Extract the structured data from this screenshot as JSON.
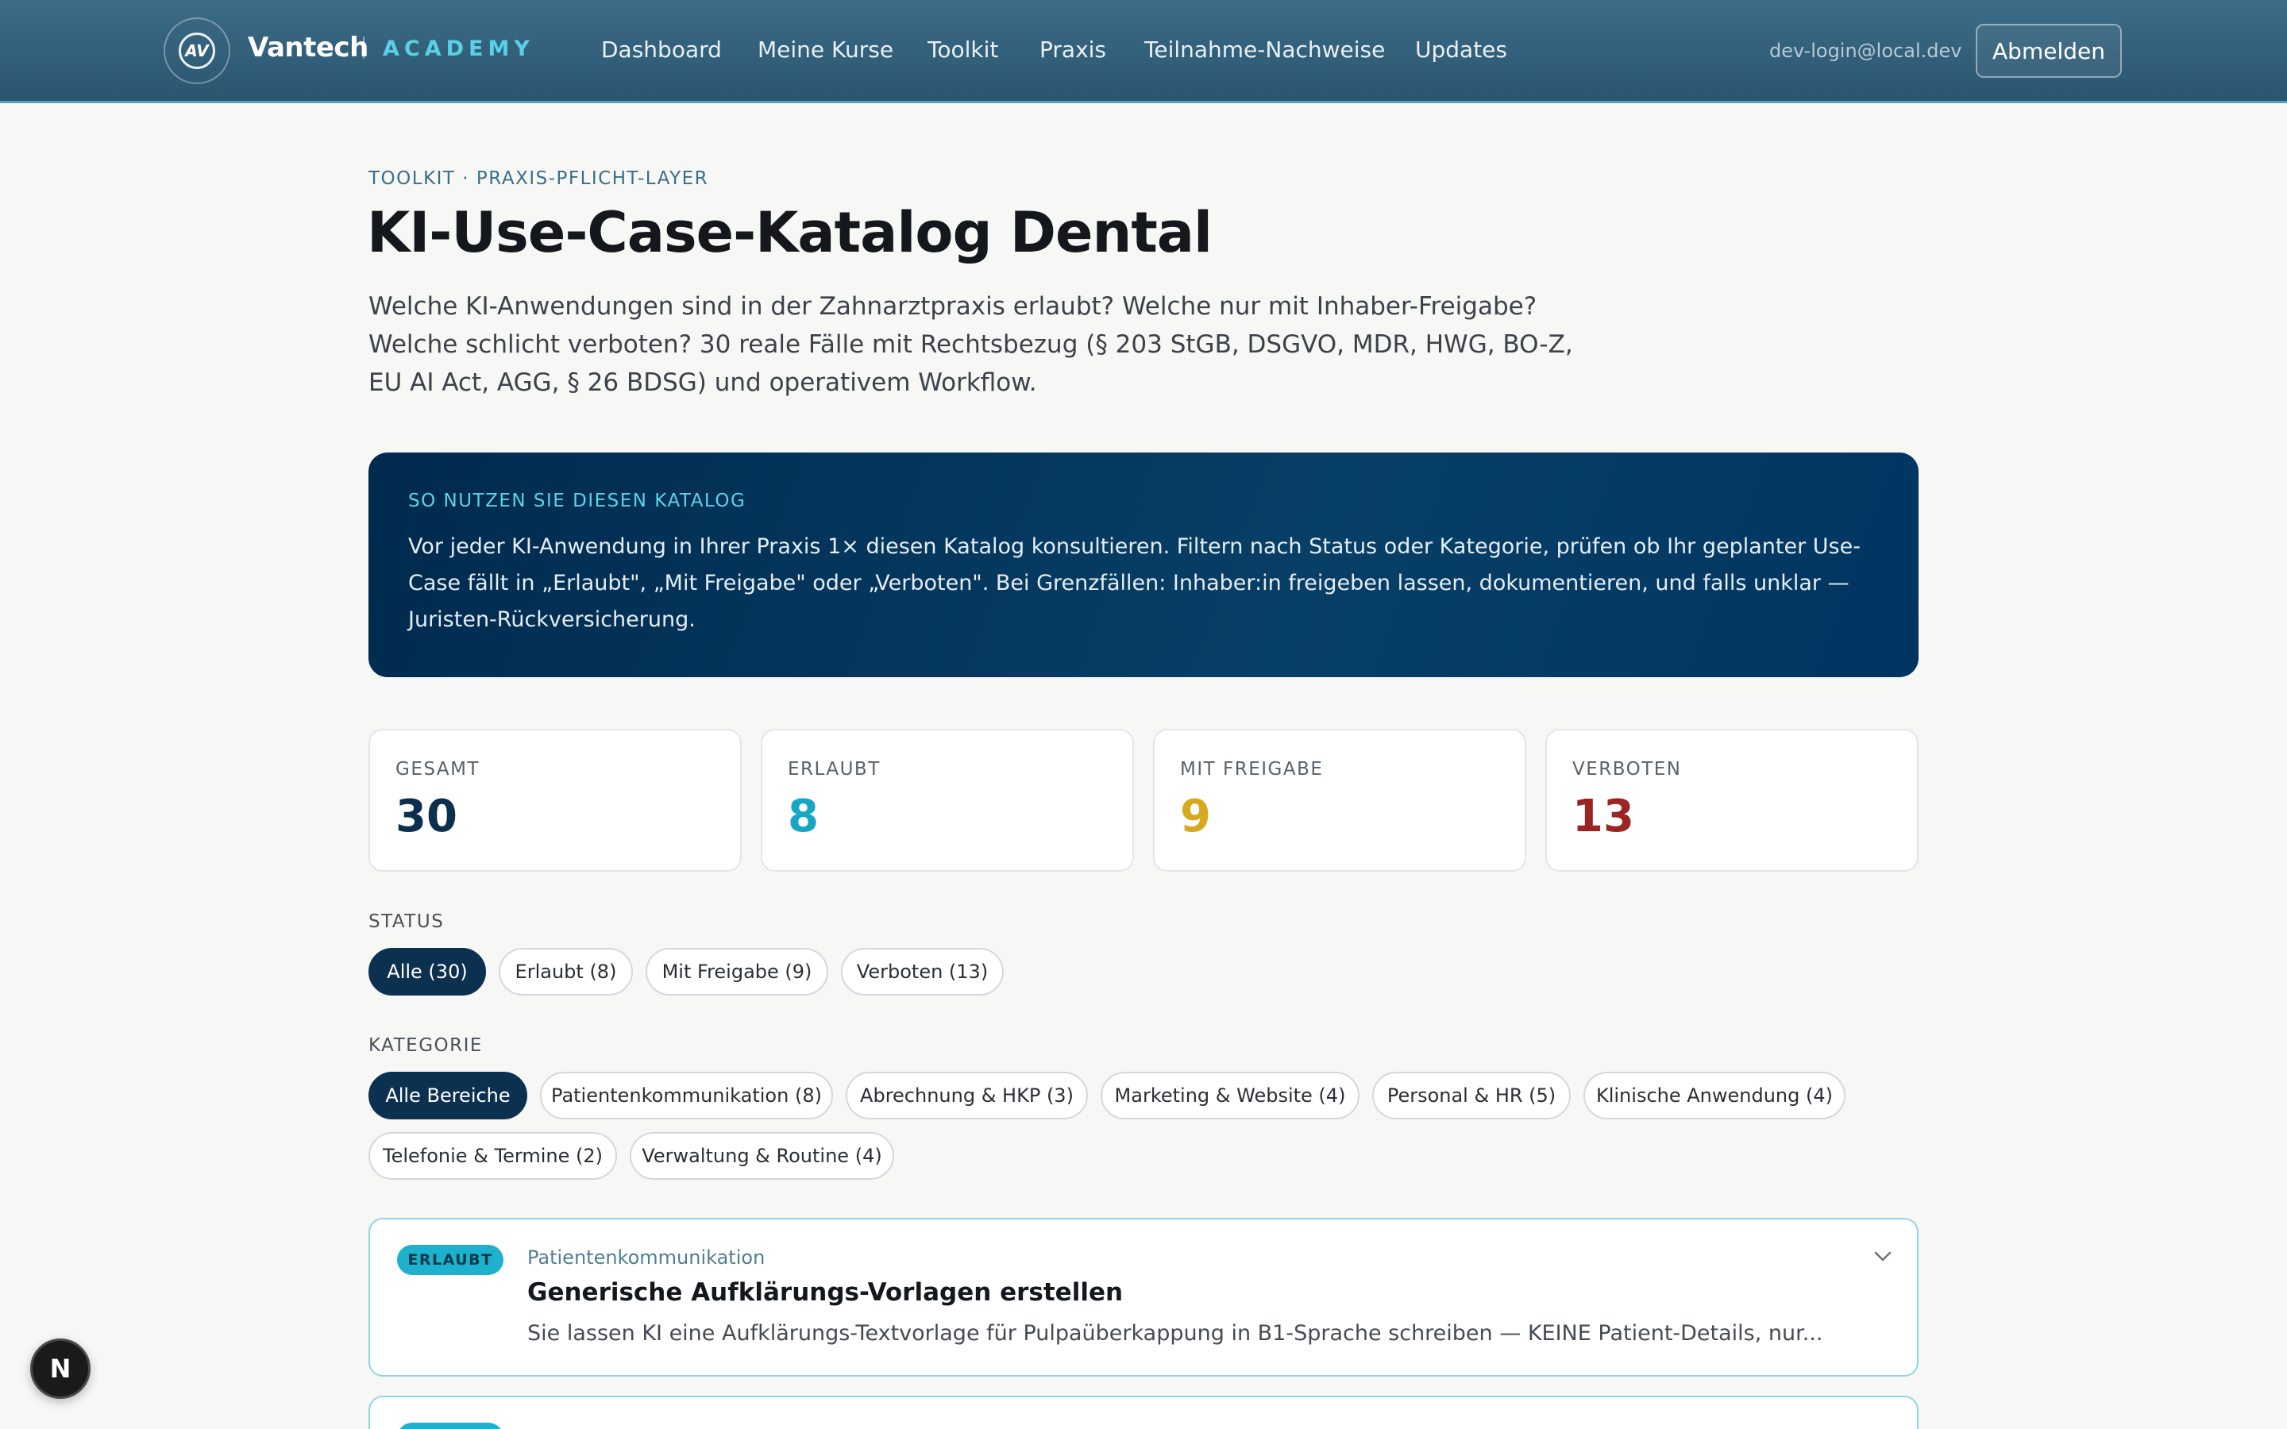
{
  "header": {
    "brand_name": "Vantech",
    "brand_sub": "ACADEMY",
    "logo_glyph": "AV",
    "nav": [
      {
        "label": "Dashboard"
      },
      {
        "label": "Meine Kurse"
      },
      {
        "label": "Toolkit"
      },
      {
        "label": "Praxis"
      },
      {
        "label": "Teilnahme-Nachweise"
      },
      {
        "label": "Updates"
      }
    ],
    "user_email": "dev-login@local.dev",
    "logout_label": "Abmelden"
  },
  "page": {
    "eyebrow": "TOOLKIT · PRAXIS-PFLICHT-LAYER",
    "title": "KI-Use-Case-Katalog Dental",
    "intro": "Welche KI-Anwendungen sind in der Zahnarztpraxis erlaubt? Welche nur mit Inhaber-Freigabe? Welche schlicht verboten? 30 reale Fälle mit Rechtsbezug (§ 203 StGB, DSGVO, MDR, HWG, BO-Z, EU AI Act, AGG, § 26 BDSG) und operativem Workflow."
  },
  "info_panel": {
    "kicker": "SO NUTZEN SIE DIESEN KATALOG",
    "text": "Vor jeder KI-Anwendung in Ihrer Praxis 1× diesen Katalog konsultieren. Filtern nach Status oder Kategorie, prüfen ob Ihr geplanter Use-Case fällt in „Erlaubt\", „Mit Freigabe\" oder „Verboten\". Bei Grenzfällen: Inhaber:in freigeben lassen, dokumentieren, und falls unklar — Juristen-Rückversicherung."
  },
  "stats": [
    {
      "label": "GESAMT",
      "value": "30",
      "color": "#0c2f4e"
    },
    {
      "label": "ERLAUBT",
      "value": "8",
      "color": "#18a6c4"
    },
    {
      "label": "MIT FREIGABE",
      "value": "9",
      "color": "#d7a91e"
    },
    {
      "label": "VERBOTEN",
      "value": "13",
      "color": "#9b2424"
    }
  ],
  "filters": {
    "status_label": "STATUS",
    "status_chips": [
      {
        "label": "Alle (30)",
        "active": true
      },
      {
        "label": "Erlaubt (8)",
        "active": false
      },
      {
        "label": "Mit Freigabe (9)",
        "active": false
      },
      {
        "label": "Verboten (13)",
        "active": false
      }
    ],
    "category_label": "KATEGORIE",
    "category_chips": [
      {
        "label": "Alle Bereiche",
        "active": true
      },
      {
        "label": "Patientenkommunikation (8)",
        "active": false
      },
      {
        "label": "Abrechnung & HKP (3)",
        "active": false
      },
      {
        "label": "Marketing & Website (4)",
        "active": false
      },
      {
        "label": "Personal & HR (5)",
        "active": false
      },
      {
        "label": "Klinische Anwendung (4)",
        "active": false
      },
      {
        "label": "Telefonie & Termine (2)",
        "active": false
      },
      {
        "label": "Verwaltung & Routine (4)",
        "active": false
      }
    ]
  },
  "cases": [
    {
      "status": "ERLAUBT",
      "category": "Patientenkommunikation",
      "title": "Generische Aufklärungs-Vorlagen erstellen",
      "description": "Sie lassen KI eine Aufklärungs-Textvorlage für Pulpaüberkappung in B1-Sprache schreiben — KEINE Patient-Details, nur...",
      "chevron_icon": "chevron-down-icon"
    }
  ],
  "floating_badge": "N"
}
